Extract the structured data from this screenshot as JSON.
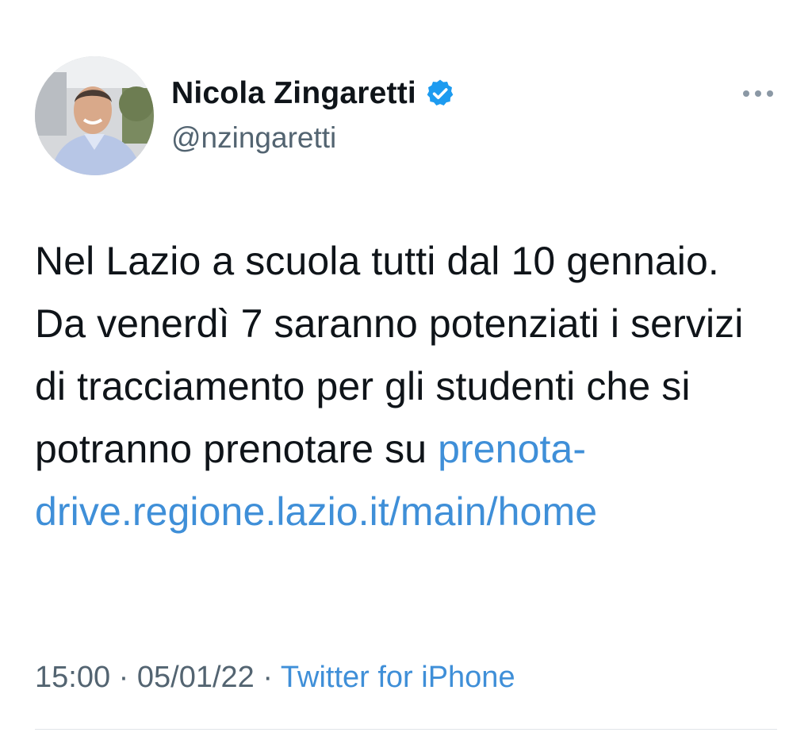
{
  "author": {
    "name": "Nicola Zingaretti",
    "handle": "@nzingaretti",
    "verified_icon": "verified-badge-icon",
    "avatar_icon": "profile-photo"
  },
  "tweet": {
    "text_plain": "Nel Lazio a scuola tutti dal 10 gennaio. Da venerdì 7 saranno potenziati i servizi di tracciamento per gli studenti che si potranno prenotare su ",
    "link_text": "prenota-drive.regione.lazio.it/main/home"
  },
  "meta": {
    "time": "15:00",
    "separator": "·",
    "date": "05/01/22",
    "source": "Twitter for iPhone"
  },
  "more_icon": "ellipsis-icon",
  "colors": {
    "link": "#3f8fd8",
    "verified": "#1d9bf0",
    "secondary_text": "#536471"
  }
}
